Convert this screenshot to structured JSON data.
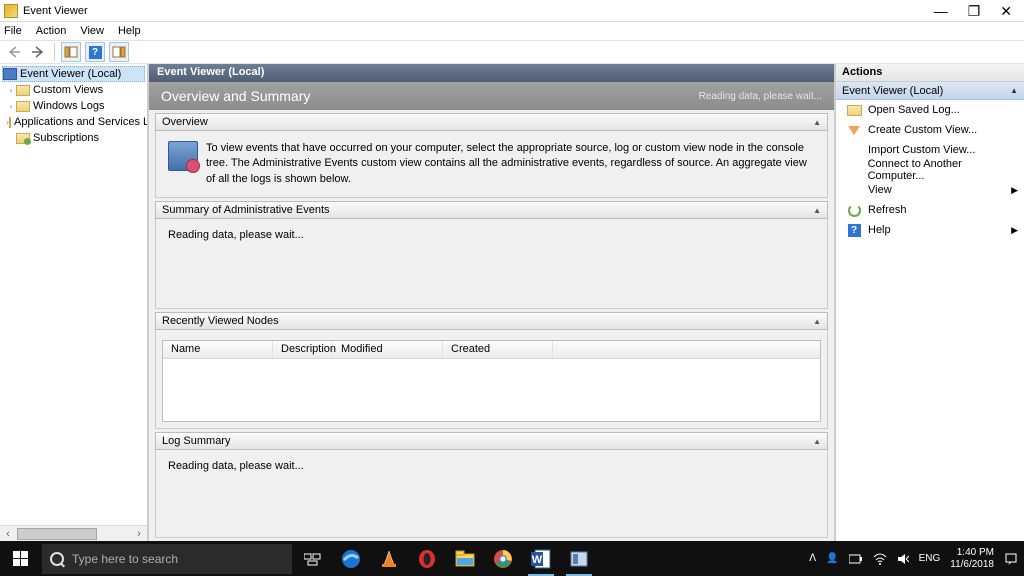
{
  "window": {
    "title": "Event Viewer"
  },
  "menu": {
    "file": "File",
    "action": "Action",
    "view": "View",
    "help": "Help"
  },
  "tree": {
    "root": "Event Viewer (Local)",
    "custom": "Custom Views",
    "winlogs": "Windows Logs",
    "apps": "Applications and Services Lo",
    "subs": "Subscriptions"
  },
  "center": {
    "header": "Event Viewer (Local)",
    "title": "Overview and Summary",
    "status": "Reading data, please wait...",
    "overview_hdr": "Overview",
    "overview_text": "To view events that have occurred on your computer, select the appropriate source, log or custom view node in the console tree. The Administrative Events custom view contains all the administrative events, regardless of source. An aggregate view of all the logs is shown below.",
    "summary_hdr": "Summary of Administrative Events",
    "summary_wait": "Reading data, please wait...",
    "recent_hdr": "Recently Viewed Nodes",
    "cols": {
      "name": "Name",
      "desc": "Description",
      "mod": "Modified",
      "created": "Created"
    },
    "logsum_hdr": "Log Summary",
    "logsum_wait": "Reading data, please wait..."
  },
  "actions": {
    "hdr": "Actions",
    "sub": "Event Viewer (Local)",
    "open": "Open Saved Log...",
    "create": "Create Custom View...",
    "import": "Import Custom View...",
    "connect": "Connect to Another Computer...",
    "view": "View",
    "refresh": "Refresh",
    "help": "Help"
  },
  "taskbar": {
    "search": "Type here to search",
    "lang": "ENG",
    "time": "1:40 PM",
    "date": "11/6/2018"
  }
}
